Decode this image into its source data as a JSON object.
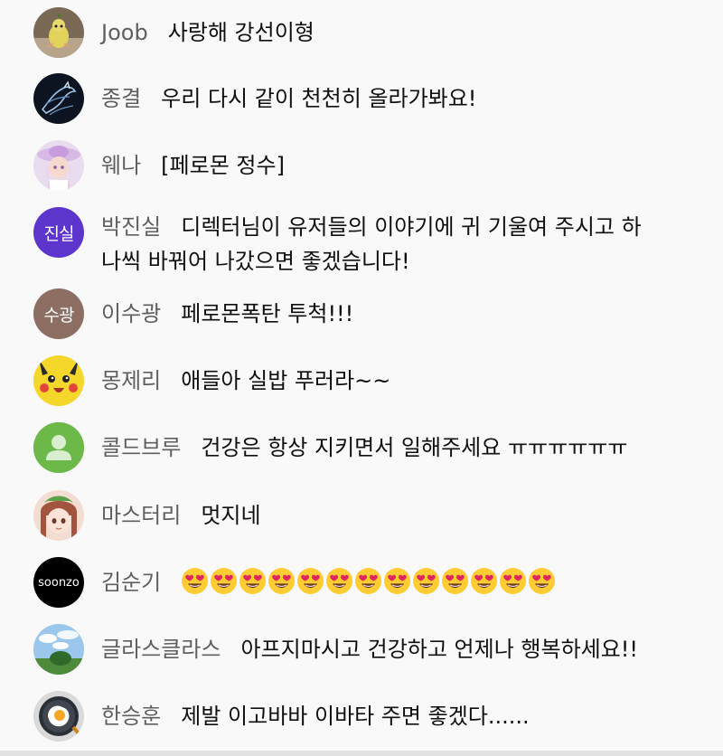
{
  "messages": [
    {
      "author": "Joob",
      "text": "사랑해 강선이형",
      "avatar_icon": "pear-bird-avatar-icon"
    },
    {
      "author": "종결",
      "text": "우리 다시 같이 천천히 올라가봐요!",
      "avatar_icon": "dark-horse-avatar-icon"
    },
    {
      "author": "웨나",
      "text": "[페로몬 정수]",
      "avatar_icon": "anime-girl-hat-avatar-icon"
    },
    {
      "author": "박진실",
      "text": "디렉터님이 유저들의 이야기에 귀 기울여 주시고 하",
      "text2": "나씩 바꿔어 나갔으면 좋겠습니다!",
      "avatar_initials": "진실",
      "avatar_color": "#5c35cc"
    },
    {
      "author": "이수광",
      "text": "페로몬폭탄 투척!!!",
      "avatar_initials": "수광",
      "avatar_color": "#8d6e63"
    },
    {
      "author": "몽제리",
      "text": "애들아 실밥 푸러라~~",
      "avatar_icon": "pikachu-avatar-icon"
    },
    {
      "author": "콜드브루",
      "text": "건강은 항상 지키면서 일해주세요 ㅠㅠㅠㅠㅠㅠ",
      "avatar_icon": "default-person-avatar-icon",
      "avatar_color": "#6cb94a"
    },
    {
      "author": "마스터리",
      "text": "멋지네",
      "avatar_icon": "anime-girl-avatar-icon"
    },
    {
      "author": "김순기",
      "text": "",
      "avatar_text": "soonzo",
      "emoji_count": 13,
      "emoji_icon": "heart-eyes-emoji-icon"
    },
    {
      "author": "글라스클라스",
      "text": "아프지마시고 건강하고 언제나 행복하세요!!",
      "avatar_icon": "sky-landscape-avatar-icon"
    },
    {
      "author": "한승훈",
      "text": "제발 이고바바 이바타 주면 좋겠다......",
      "avatar_icon": "fried-egg-pan-avatar-icon"
    }
  ],
  "colors": {
    "background": "#f9f9f9",
    "author": "#5f5f5f",
    "text": "#0f0f0f"
  }
}
